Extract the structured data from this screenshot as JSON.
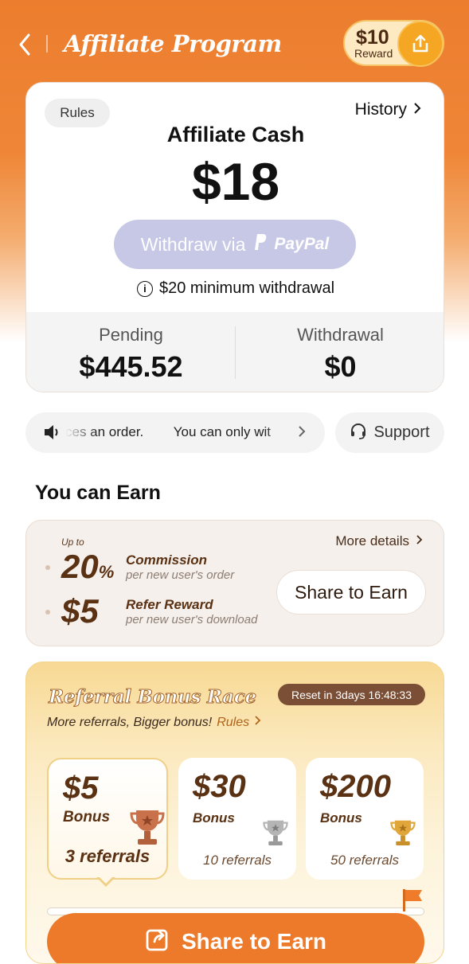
{
  "header": {
    "title": "Affiliate Program",
    "reward_amount": "$10",
    "reward_label": "Reward"
  },
  "cash_card": {
    "rules_label": "Rules",
    "history_label": "History",
    "title": "Affiliate Cash",
    "amount": "$18",
    "withdraw_label": "Withdraw via",
    "withdraw_method": "PayPal",
    "min_note": "$20 minimum withdrawal",
    "pending_label": "Pending",
    "pending_value": "$445.52",
    "withdrawal_label": "Withdrawal",
    "withdrawal_value": "$0"
  },
  "notice": {
    "text": "ces an order.        You can only wit",
    "support_label": "Support"
  },
  "earn": {
    "heading": "You can Earn",
    "upto_label": "Up to",
    "commission_value": "20",
    "commission_unit": "%",
    "commission_title": "Commission",
    "commission_sub": "per new user's order",
    "refer_value": "$5",
    "refer_title": "Refer Reward",
    "refer_sub": "per new user's download",
    "more_details": "More details",
    "share_label": "Share to Earn"
  },
  "race": {
    "title": "Referral Bonus Race",
    "reset_text": "Reset in 3days 16:48:33",
    "subtitle": "More referrals, Bigger bonus!",
    "rules_label": "Rules",
    "tiers": [
      {
        "amount": "$5",
        "bonus": "Bonus",
        "referrals": "3 referrals"
      },
      {
        "amount": "$30",
        "bonus": "Bonus",
        "referrals": "10 referrals"
      },
      {
        "amount": "$200",
        "bonus": "Bonus",
        "referrals": "50 referrals"
      }
    ],
    "progress_fraction": 0,
    "share_label": "Share to Earn"
  },
  "colors": {
    "brand_orange": "#ec7a2a",
    "brown_text": "#5a3112",
    "withdraw_disabled": "#c6c8e6"
  }
}
